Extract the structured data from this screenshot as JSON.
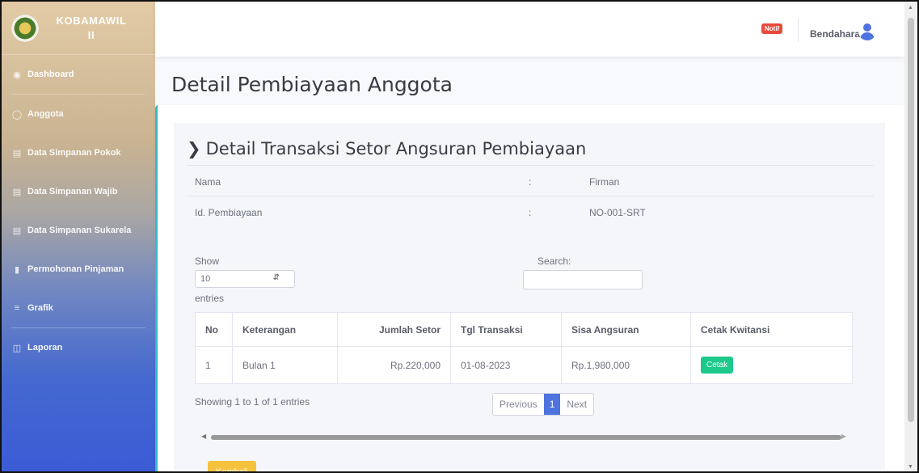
{
  "brand": {
    "name": "KOBAMAWIL\nII",
    "line1": "KOBAMAWIL",
    "line2": "II"
  },
  "sidebar": {
    "items": [
      {
        "label": "Dashboard",
        "icon": "dashboard-icon"
      },
      {
        "label": "Anggota",
        "icon": "user-icon"
      },
      {
        "label": "Data Simpanan Pokok",
        "icon": "list-icon"
      },
      {
        "label": "Data Simpanan Wajib",
        "icon": "list-icon"
      },
      {
        "label": "Data Simpanan Sukarela",
        "icon": "list-icon"
      },
      {
        "label": "Permohonan Pinjaman",
        "icon": "file-icon"
      },
      {
        "label": "Grafik",
        "icon": "bars-icon"
      },
      {
        "label": "Laporan",
        "icon": "report-icon"
      }
    ]
  },
  "topbar": {
    "notif_label": "Notif",
    "username": "Bendahara"
  },
  "page": {
    "title": "Detail Pembiayaan Anggota"
  },
  "section": {
    "title": "Detail Transaksi Setor Angsuran Pembiayaan",
    "info": [
      {
        "label": "Nama",
        "sep": ":",
        "value": "Firman"
      },
      {
        "label": "Id. Pembiayaan",
        "sep": ":",
        "value": "NO-001-SRT"
      }
    ]
  },
  "datatable": {
    "show_label": "Show",
    "entries_label": "entries",
    "length_value": "10",
    "search_label": "Search:",
    "search_value": "",
    "columns": [
      "No",
      "Keterangan",
      "Jumlah Setor",
      "Tgl Transaksi",
      "Sisa Angsuran",
      "Cetak Kwitansi"
    ],
    "rows": [
      {
        "no": "1",
        "keterangan": "Bulan 1",
        "jumlah": "Rp.220,000",
        "tgl": "01-08-2023",
        "sisa": "Rp.1,980,000",
        "cetak": "Cetak"
      }
    ],
    "info": "Showing 1 to 1 of 1 entries",
    "pager": {
      "previous": "Previous",
      "current": "1",
      "next": "Next"
    }
  },
  "actions": {
    "back_label": "Kembali"
  },
  "colors": {
    "primary": "#4e73df",
    "success": "#1cc88a",
    "warning": "#f6c23e",
    "info": "#36b9cc",
    "danger": "#e74a3b"
  }
}
